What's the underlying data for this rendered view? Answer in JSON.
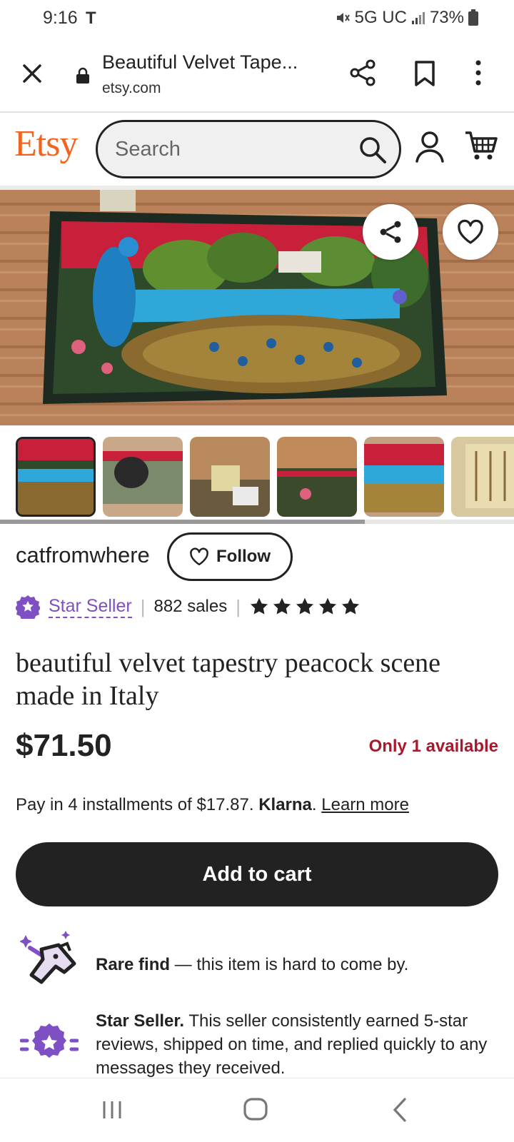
{
  "status_bar": {
    "time": "9:16",
    "carrier_icon": "T",
    "network": "5G UC",
    "battery": "73%"
  },
  "browser": {
    "title": "Beautiful Velvet Tape...",
    "domain": "etsy.com"
  },
  "etsy_header": {
    "logo": "Etsy",
    "search_placeholder": "Search"
  },
  "shop": {
    "name": "catfromwhere",
    "follow_label": "Follow",
    "star_seller_label": "Star Seller",
    "sales": "882 sales",
    "rating_stars": 5
  },
  "listing": {
    "title": "beautiful velvet tapestry peacock scene made in Italy",
    "price": "$71.50",
    "availability": "Only 1 available",
    "klarna_prefix": "Pay in 4 installments of $17.87.",
    "klarna_brand": "Klarna",
    "klarna_period": ".",
    "klarna_learn_more": "Learn more",
    "add_to_cart_label": "Add to cart"
  },
  "highlights": {
    "rare_find_bold": "Rare find",
    "rare_find_text": " — this item is hard to come by.",
    "star_seller_bold": "Star Seller.",
    "star_seller_text": " This seller consistently earned 5-star reviews, shipped on time, and replied quickly to any messages they received."
  },
  "colors": {
    "etsy_orange": "#F1641E",
    "star_seller_purple": "#7F4FC4",
    "availability_red": "#A61A2E",
    "button_dark": "#222222"
  },
  "thumbnails": {
    "count": 6,
    "selected_index": 0,
    "scroll_fraction": 0.71
  }
}
